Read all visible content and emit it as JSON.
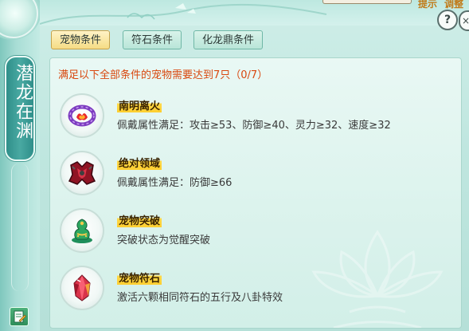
{
  "window": {
    "vertical_title": "潜龙在渊",
    "top_links": [
      "提示",
      "调整"
    ]
  },
  "tabs": [
    {
      "label": "宠物条件",
      "active": true
    },
    {
      "label": "符石条件",
      "active": false
    },
    {
      "label": "化龙鼎条件",
      "active": false
    }
  ],
  "header_buttons": {
    "help_label": "?",
    "close_label": "×"
  },
  "requirement": "满足以下全部条件的宠物需要达到7只（0/7）",
  "items": [
    {
      "name": "南明离火",
      "desc": "佩戴属性满足：攻击≥53、防御≥40、灵力≥32、速度≥32",
      "icon": "fire-bracelet-icon"
    },
    {
      "name": "绝对领域",
      "desc": "佩戴属性满足：防御≥66",
      "icon": "red-armor-icon"
    },
    {
      "name": "宠物突破",
      "desc": "突破状态为觉醒突破",
      "icon": "jade-gourd-icon"
    },
    {
      "name": "宠物符石",
      "desc": "激活六颗相同符石的五行及八卦特效",
      "icon": "crystal-gem-icon"
    }
  ],
  "colors": {
    "accent_orange": "#d9480f",
    "name_highlight": "#ffd94a",
    "panel_bg": "#dcf3ed"
  }
}
